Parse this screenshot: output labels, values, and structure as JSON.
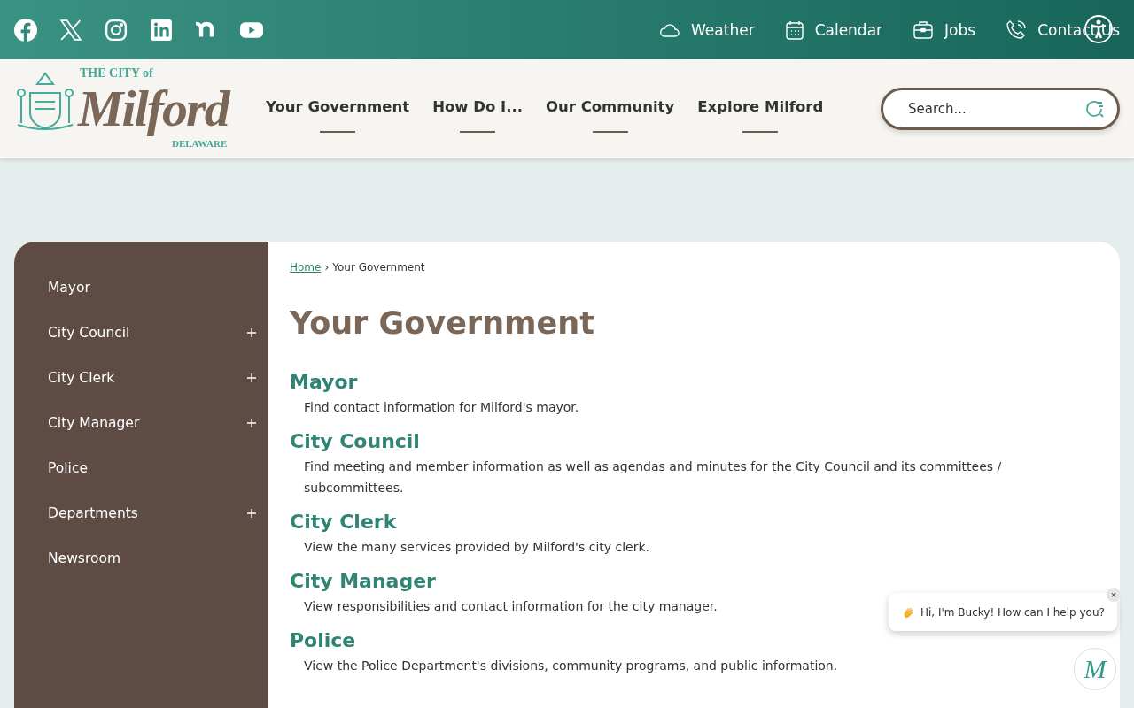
{
  "top_bar": {
    "links": [
      {
        "label": "Weather"
      },
      {
        "label": "Calendar"
      },
      {
        "label": "Jobs"
      },
      {
        "label": "Contact Us"
      }
    ]
  },
  "logo": {
    "line_1": "THE CITY of",
    "line_2": "Milford",
    "line_3": "DELAWARE"
  },
  "nav": [
    "Your Government",
    "How Do I...",
    "Our Community",
    "Explore Milford"
  ],
  "search": {
    "placeholder": "Search..."
  },
  "sidebar": {
    "items": [
      {
        "label": "Mayor",
        "expandable": false
      },
      {
        "label": "City Council",
        "expandable": true
      },
      {
        "label": "City Clerk",
        "expandable": true
      },
      {
        "label": "City Manager",
        "expandable": true
      },
      {
        "label": "Police",
        "expandable": false
      },
      {
        "label": "Departments",
        "expandable": true
      },
      {
        "label": "Newsroom",
        "expandable": false
      }
    ]
  },
  "breadcrumb": {
    "home": "Home",
    "separator": "›",
    "current": "Your Government"
  },
  "page_title": "Your Government",
  "sections": [
    {
      "title": "Mayor",
      "text": "Find contact information for Milford's mayor."
    },
    {
      "title": "City Council",
      "text": "Find meeting and member information as well as agendas and minutes for the City Council and its committees / subcommittees."
    },
    {
      "title": "City Clerk",
      "text": "View the many services provided by Milford's city clerk."
    },
    {
      "title": "City Manager",
      "text": "View responsibilities and contact information for the city manager."
    },
    {
      "title": "Police",
      "text": "View the Police Department's divisions, community programs, and public information."
    }
  ],
  "chat": {
    "message": "Hi, I'm Bucky! How can I help you?",
    "close": "×",
    "launcher_letter": "M"
  }
}
